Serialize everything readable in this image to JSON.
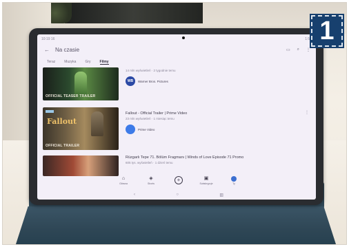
{
  "status_bar": {
    "time": "10:19 16",
    "right": "1:58"
  },
  "header": {
    "title": "Na czasie"
  },
  "tabs": [
    {
      "label": "Teraz"
    },
    {
      "label": "Muzyka"
    },
    {
      "label": "Gry"
    },
    {
      "label": "Filmy",
      "active": true
    }
  ],
  "videos": [
    {
      "title": "",
      "meta": "14 mln wyświetleń · 2 tygodnie temu",
      "channel": "Warner Bros. Pictures",
      "channel_initials": "WB",
      "thumb_caption": "OFFICIAL TEASER TRAILER"
    },
    {
      "title": "Fallout - Official Trailer | Prime Video",
      "meta": "23 mln wyświetleń · 1 miesiąc temu",
      "channel": "Prime Video",
      "channel_initials": "",
      "thumb_logo": "Fallout",
      "thumb_caption": "OFFICIAL TRAILER"
    },
    {
      "title": "Rüzgarlı Tepe 71. Bölüm Fragmanı | Winds of Love Episode 71 Promo",
      "meta": "605 tys. wyświetleń · 1 dzień temu",
      "channel": "",
      "channel_initials": ""
    }
  ],
  "bottom_nav": [
    {
      "label": "Główna",
      "icon": "home-icon"
    },
    {
      "label": "Shorts",
      "icon": "shorts-icon"
    },
    {
      "label": "",
      "icon": "add-icon"
    },
    {
      "label": "Subskrypcje",
      "icon": "subscriptions-icon"
    },
    {
      "label": "Ty",
      "icon": "you-avatar"
    }
  ],
  "badge": {
    "number": "1",
    "color": "#17406e"
  }
}
